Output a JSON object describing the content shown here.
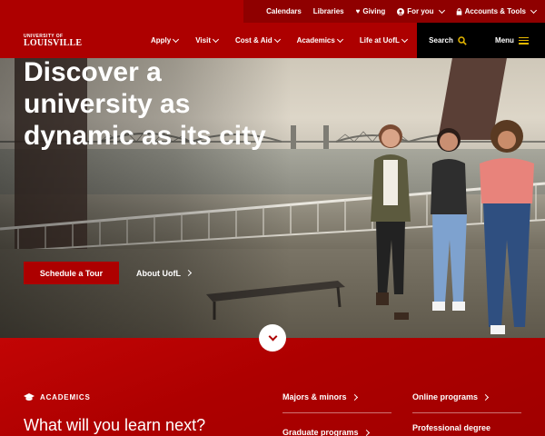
{
  "utility": {
    "calendars": "Calendars",
    "libraries": "Libraries",
    "giving": "Giving",
    "for_you": "For you",
    "accounts": "Accounts & Tools"
  },
  "logo": {
    "line1": "UNIVERSITY OF",
    "line2": "LOUISVILLE"
  },
  "nav": {
    "items": [
      {
        "label": "Apply"
      },
      {
        "label": "Visit"
      },
      {
        "label": "Cost & Aid"
      },
      {
        "label": "Academics"
      },
      {
        "label": "Life at UofL"
      }
    ],
    "search": "Search",
    "menu": "Menu"
  },
  "hero": {
    "title": "Discover a university as dynamic as its city",
    "primary_button": "Schedule a Tour",
    "secondary_link": "About UofL"
  },
  "academics": {
    "label": "ACADEMICS",
    "heading": "What will you learn next?",
    "links": [
      {
        "label": "Majors & minors"
      },
      {
        "label": "Online programs"
      },
      {
        "label": "Graduate programs"
      },
      {
        "label": "Professional degree"
      }
    ]
  },
  "colors": {
    "brand_red": "#ad0000",
    "dark": "#000000",
    "accent_gold": "#e7b800"
  },
  "icons": [
    "heart-icon",
    "person-icon",
    "lock-icon",
    "search-icon",
    "hamburger-icon",
    "chevron-down-icon",
    "chevron-right-icon",
    "graduation-cap-icon"
  ]
}
